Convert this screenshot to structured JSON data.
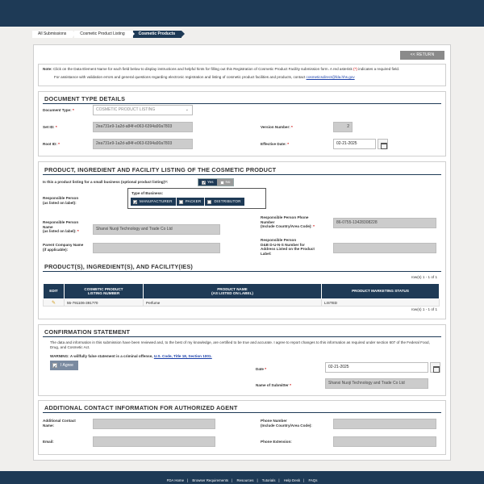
{
  "breadcrumbs": [
    "All Submissions",
    "Cosmetic Product Listing",
    "Cosmetic Products"
  ],
  "return_label": "<< RETURN",
  "note": {
    "prefix": "Note:",
    "text": " Click on the Data Element Name for each field below to display instructions and helpful hints for filling out this Registration of Cosmetic Product Facility submission form. A red asterisk ",
    "asterisk": "(*)",
    "text2": " indicates a required field.",
    "assist": "For assistance with validation errors and general questions regarding electronic registration and listing of cosmetic product facilities and products, contact ",
    "email": "cosmeticsdirect@fda.hhs.gov"
  },
  "doc_type": {
    "title": "DOCUMENT TYPE DETAILS",
    "document_type_label": "Document Type:",
    "document_type_value": "COSMETIC PRODUCT LISTING",
    "set_id_label": "Set ID:",
    "set_id_value": "2ea731e9-1a2d-a84f-e063-6394a90a7803",
    "root_id_label": "Root ID:",
    "root_id_value": "2ea731e9-1a2d-a84f-e063-6394a90a7803",
    "version_label": "Version Number:",
    "version_value": "2",
    "effective_date_label": "Effective Date:",
    "effective_date_value": "02-21-2025"
  },
  "listing": {
    "title": "PRODUCT, INGREDIENT AND FACILITY LISTING OF THE COSMETIC PRODUCT",
    "small_business_q": "Is this a product listing for a small business (optional product listing)?:",
    "yes_label": "Yes",
    "no_label": "No",
    "rp_label_1": "Responsible Person",
    "rp_label_2": "(as listed on label):",
    "type_of_business_label": "Type of Business:",
    "business_types": [
      "MANUFACTURER",
      "PACKER",
      "DISTRIBUTOR"
    ],
    "rp_name_label_1": "Responsible Person",
    "rp_name_label_2": "Name",
    "rp_name_label_3": "(as listed on label):",
    "rp_name_value": "Shanxi Nuoji Technology and Trade Co Ltd",
    "rp_phone_label_1": "Responsible Person Phone",
    "rp_phone_label_2": "Number",
    "rp_phone_label_3": "(Include Country/Area Code):",
    "rp_phone_value": "86-0755-13428308228",
    "parent_label_1": "Parent Company Name",
    "parent_label_2": "(if applicable):",
    "duns_label_1": "Responsible Person",
    "duns_label_2": "D&B D-U-N-S Number for",
    "duns_label_3": "Address Listed on the Product",
    "duns_label_4": "Label:"
  },
  "products": {
    "title": "PRODUCT(S), INGREDIENT(S), AND FACILITY(IES)",
    "rows_info": "row(s) 1 - 1 of 1",
    "headers": [
      "EDIT",
      "COSMETIC PRODUCT LISTING NUMBER",
      "PRODUCT NAME (AS LISTED ON LABEL)",
      "PRODUCT MARKETING STATUS"
    ],
    "header_lines": [
      [
        "EDIT"
      ],
      [
        "COSMETIC PRODUCT",
        "LISTING NUMBER"
      ],
      [
        "PRODUCT NAME",
        "(AS LISTED ON LABEL)"
      ],
      [
        "PRODUCT MARKETING STATUS"
      ]
    ],
    "rows": [
      [
        "",
        "55-791106-391770",
        "Perfume",
        "LISTED"
      ]
    ]
  },
  "confirmation": {
    "title": "CONFIRMATION STATEMENT",
    "statement": "The data and information in this submission have been reviewed and, to the best of my knowledge, are certified to be true and accurate. I agree to report changes to this information as required under section 607 of the Federal Food, Drug, and Cosmetic Act.",
    "warning": "WARNING: A willfully false statement is a criminal offense, ",
    "code_link": "U.S. Code, Title 18, Section 1001.",
    "agree_label": "I Agree",
    "date_label": "Date",
    "date_value": "02-21-2025",
    "submitter_label": "Name of Submitter",
    "submitter_value": "Shanxi Nuoji Technology and Trade Co Ltd"
  },
  "contact": {
    "title": "ADDITIONAL CONTACT INFORMATION FOR AUTHORIZED AGENT",
    "add_contact_label_1": "Additional Contact",
    "add_contact_label_2": "Name:",
    "email_label": "Email:",
    "phone_label_1": "Phone Number",
    "phone_label_2": "(Include Country/Area Code):",
    "ext_label": "Phone Extension:"
  },
  "footer": [
    "FDA Home",
    "Browser Requirements",
    "Resources",
    "Tutorials",
    "Help Desk",
    "FAQs"
  ],
  "colors": {
    "navy": "#1e3a56",
    "required": "#c00000",
    "field_gray": "#cccccc"
  }
}
